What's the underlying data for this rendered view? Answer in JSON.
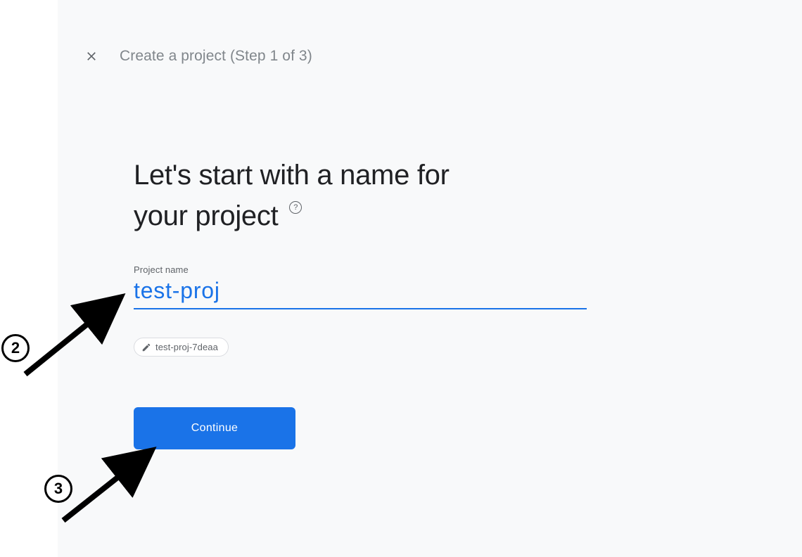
{
  "header": {
    "step_title": "Create a project (Step 1 of 3)"
  },
  "headline": {
    "line1": "Let's start with a name for",
    "line2": "your project",
    "help_glyph": "?"
  },
  "field": {
    "label": "Project name",
    "value": "test-proj"
  },
  "id_chip": {
    "text": "test-proj-7deaa"
  },
  "actions": {
    "continue_label": "Continue"
  },
  "annotations": {
    "label_2": "2",
    "label_3": "3"
  },
  "colors": {
    "accent": "#1a73e8",
    "text_primary": "#202124",
    "text_secondary": "#5f6368",
    "panel_bg": "#f8f9fa",
    "border": "#dadce0"
  }
}
